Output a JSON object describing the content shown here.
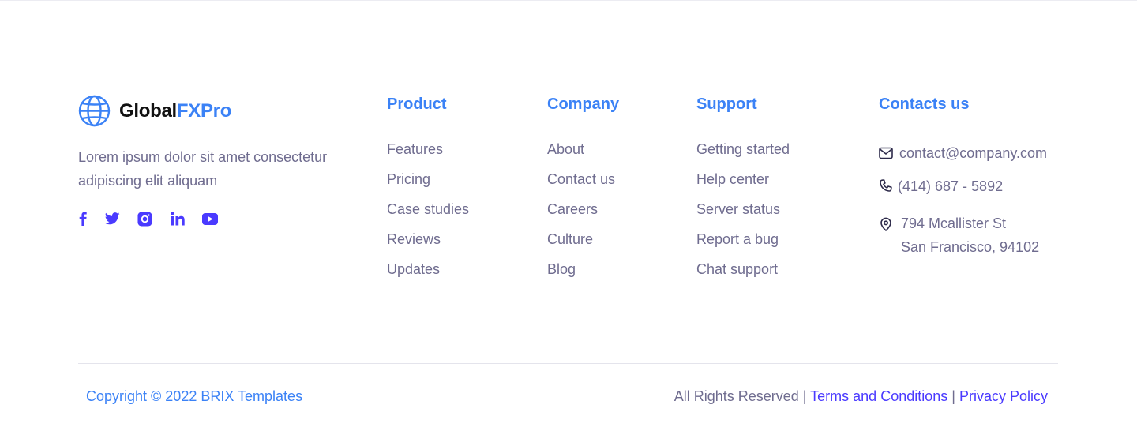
{
  "brand": {
    "name_part1": "Global",
    "name_part2": "FXPro",
    "icon": "globe-icon"
  },
  "tagline": "Lorem ipsum dolor sit amet consectetur adipiscing elit aliquam",
  "socials": [
    "facebook-icon",
    "twitter-icon",
    "instagram-icon",
    "linkedin-icon",
    "youtube-icon"
  ],
  "columns": {
    "product": {
      "title": "Product",
      "items": [
        "Features",
        "Pricing",
        "Case studies",
        "Reviews",
        "Updates"
      ]
    },
    "company": {
      "title": "Company",
      "items": [
        "About",
        "Contact us",
        "Careers",
        "Culture",
        "Blog"
      ]
    },
    "support": {
      "title": "Support",
      "items": [
        "Getting started",
        "Help center",
        "Server status",
        "Report a bug",
        "Chat support"
      ]
    }
  },
  "contact": {
    "title": "Contacts us",
    "email": "contact@company.com",
    "phone": "(414) 687 - 5892",
    "address_line1": "794 Mcallister St",
    "address_line2": "San Francisco, 94102"
  },
  "footer": {
    "copyright": "Copyright © 2022 BRIX Templates",
    "rights": "All Rights Reserved |",
    "separator": "|",
    "terms": "Terms and Conditions",
    "privacy": "Privacy Policy"
  },
  "colors": {
    "accent_blue": "#3b82f6",
    "link_purple": "#4a3aff",
    "body_text": "#6f6c8f",
    "brand_dark": "#111111"
  }
}
